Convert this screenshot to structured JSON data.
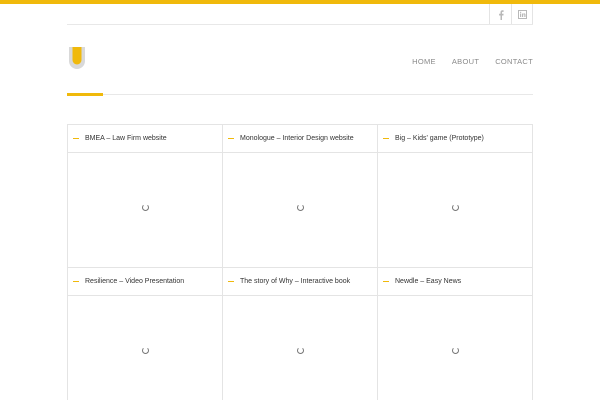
{
  "colors": {
    "accent": "#f0b90b",
    "border": "#e4e4e4",
    "nav_text": "#8a8a8a"
  },
  "social": [
    {
      "name": "facebook",
      "icon": "facebook-icon"
    },
    {
      "name": "linkedin",
      "icon": "linkedin-icon"
    }
  ],
  "logo": {
    "icon": "u-logo-icon"
  },
  "nav": {
    "home": "HOME",
    "about": "ABOUT",
    "contact": "CONTACT"
  },
  "portfolio": {
    "items": [
      {
        "title": "BMEA – Law Firm website"
      },
      {
        "title": "Monologue – Interior Design website"
      },
      {
        "title": "Big – Kids' game (Prototype)"
      },
      {
        "title": "Resilience – Video Presentation"
      },
      {
        "title": "The story of Why – Interactive book"
      },
      {
        "title": "Newdle – Easy News"
      }
    ]
  }
}
